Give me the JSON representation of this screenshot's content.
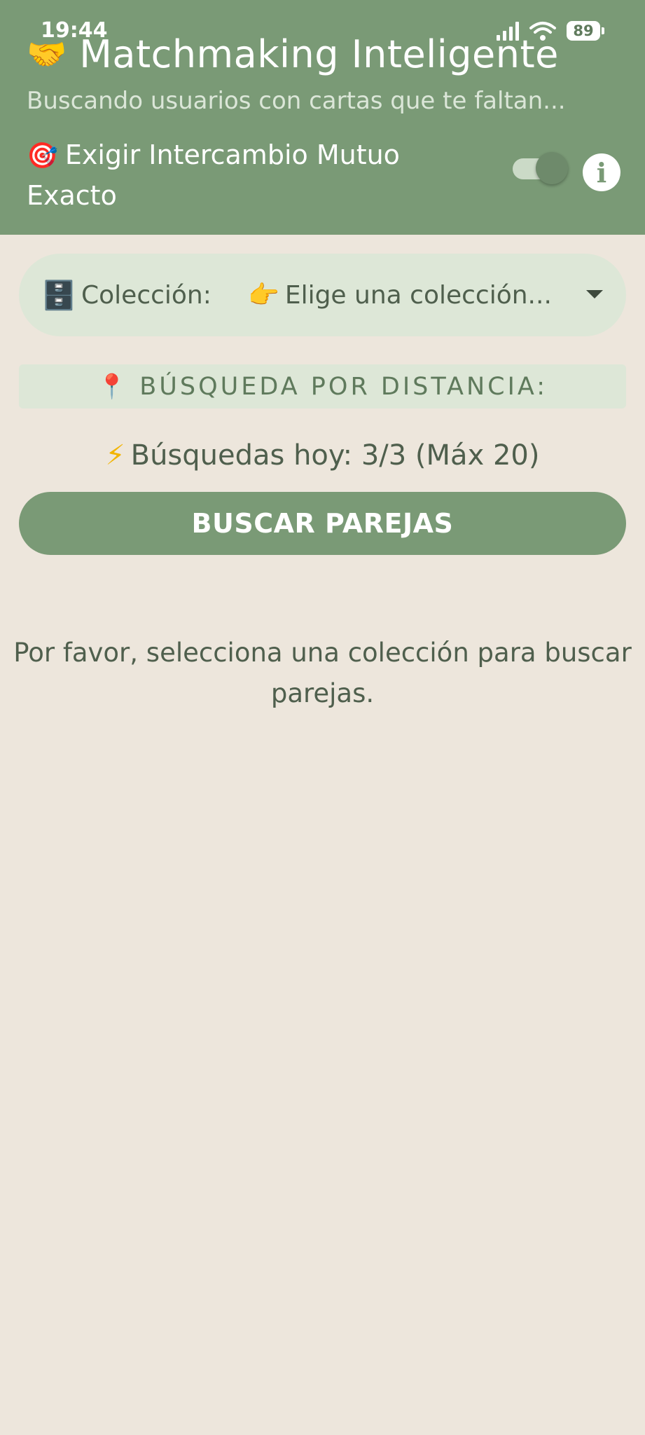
{
  "status_bar": {
    "time": "19:44",
    "battery": "89"
  },
  "header": {
    "title": "Matchmaking Inteligente",
    "subtitle": "Buscando usuarios con cartas que te faltan...",
    "mutual_exchange_label": "Exigir Intercambio Mutuo Exacto",
    "mutual_exchange_enabled": false,
    "info_icon": "i"
  },
  "collection": {
    "label": "Colección:",
    "value": "Elige una colección..."
  },
  "distance": {
    "label": "BÚSQUEDA POR DISTANCIA:"
  },
  "searches": {
    "text": "Búsquedas hoy: 3/3 (Máx 20)"
  },
  "search_button": {
    "label": "BUSCAR PAREJAS"
  },
  "empty_state": {
    "message": "Por favor, selecciona una colección para buscar parejas."
  },
  "colors": {
    "header_green": "#7a9a76",
    "background": "#ede6dc",
    "pill_green": "#dde7d7",
    "text_dark": "#4f5f4d"
  },
  "icons": {
    "title": "handshake-icon",
    "mutual": "target-icon",
    "collection": "file-cabinet-icon",
    "collection_value": "pointing-hand-icon",
    "distance": "pin-icon",
    "searches": "lightning-bolt-icon"
  }
}
